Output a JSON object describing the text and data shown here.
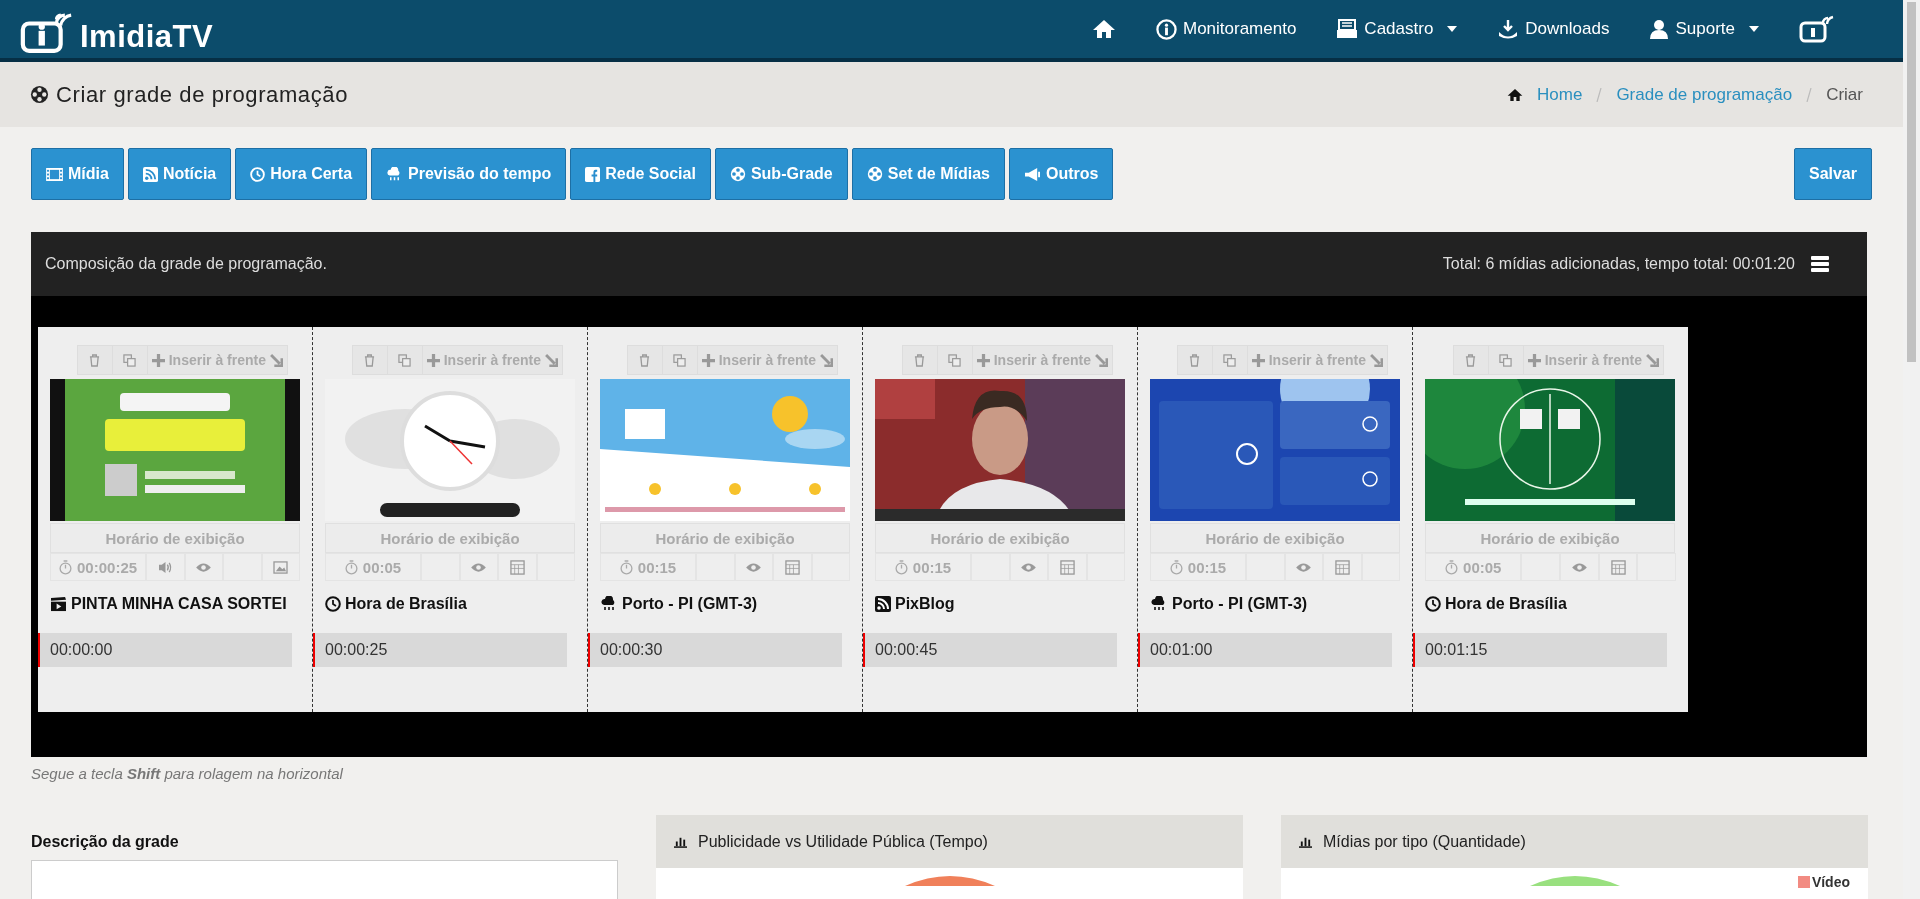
{
  "brand": "ImidiaTV",
  "nav": [
    {
      "kind": "home"
    },
    {
      "kind": "monitor",
      "label": "Monitoramento",
      "dropdown": false
    },
    {
      "kind": "register",
      "label": "Cadastro",
      "dropdown": true
    },
    {
      "kind": "download",
      "label": "Downloads",
      "dropdown": false
    },
    {
      "kind": "user",
      "label": "Suporte",
      "dropdown": true
    },
    {
      "kind": "signal"
    }
  ],
  "page_title": "Criar grade de programação",
  "breadcrumb": [
    {
      "label": "Home",
      "current": false
    },
    {
      "label": "Grade de programação",
      "current": false
    },
    {
      "label": "Criar",
      "current": true
    }
  ],
  "toolbar": [
    {
      "kind": "film",
      "label": "Mídia"
    },
    {
      "kind": "rss",
      "label": "Notícia"
    },
    {
      "kind": "clock",
      "label": "Hora Certa"
    },
    {
      "kind": "weather",
      "label": "Previsão do tempo"
    },
    {
      "kind": "facebook",
      "label": "Rede Social"
    },
    {
      "kind": "reel",
      "label": "Sub-Grade"
    },
    {
      "kind": "reel",
      "label": "Set de Mídias"
    },
    {
      "kind": "megaphone",
      "label": "Outros"
    }
  ],
  "save_button": "Salvar",
  "composition": {
    "title": "Composição da grade de programação.",
    "summary": "Total: 6 mídias adicionadas, tempo total: 00:01:20"
  },
  "cards": [
    {
      "kind": "media",
      "insert_label": "Inserir à frente",
      "schedule_label": "Horário de exibição",
      "duration": "00:00:25",
      "sound": true,
      "title": "PINTA MINHA CASA SORTEI",
      "start": "00:00:00"
    },
    {
      "kind": "clock",
      "insert_label": "Inserir à frente",
      "schedule_label": "Horário de exibição",
      "duration": "00:05",
      "sound": false,
      "title": "Hora de Brasília",
      "start": "00:00:25"
    },
    {
      "kind": "weather",
      "insert_label": "Inserir à frente",
      "schedule_label": "Horário de exibição",
      "duration": "00:15",
      "sound": false,
      "title": "Porto - PI (GMT-3)",
      "start": "00:00:30"
    },
    {
      "kind": "rss",
      "insert_label": "Inserir à frente",
      "schedule_label": "Horário de exibição",
      "duration": "00:15",
      "sound": false,
      "title": "PixBlog",
      "start": "00:00:45"
    },
    {
      "kind": "weather",
      "insert_label": "Inserir à frente",
      "schedule_label": "Horário de exibição",
      "duration": "00:15",
      "sound": false,
      "title": "Porto - PI (GMT-3)",
      "start": "00:01:00"
    },
    {
      "kind": "clock",
      "insert_label": "Inserir à frente",
      "schedule_label": "Horário de exibição",
      "duration": "00:05",
      "sound": false,
      "title": "Hora de Brasília",
      "start": "00:01:15"
    }
  ],
  "hint": "Segue a tecla **Shift** para rolagem na horizontal",
  "description_label": "Descrição da grade",
  "charts": [
    {
      "title": "Publicidade vs Utilidade Pública (Tempo)",
      "color": "#f0805a"
    },
    {
      "title": "Mídias por tipo (Quantidade)",
      "color": "#99e07f",
      "legend": [
        {
          "label": "Vídeo",
          "color": "#f28b82"
        }
      ]
    }
  ]
}
